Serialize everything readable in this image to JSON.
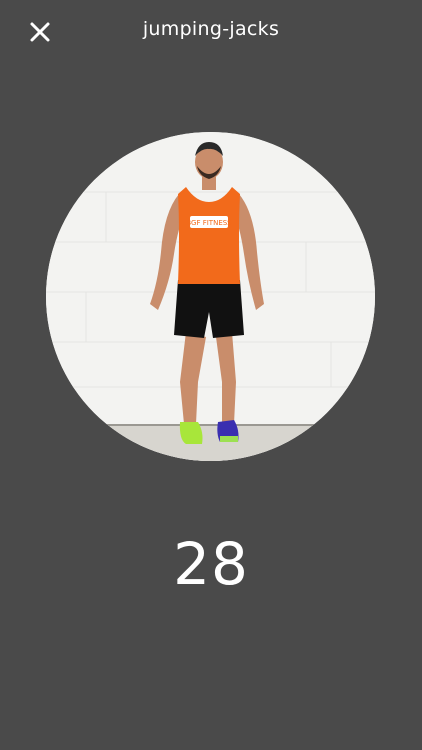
{
  "header": {
    "close_icon": "close-icon",
    "title": "jumping-jacks"
  },
  "exercise": {
    "image": "person-doing-jumping-jacks",
    "shirt_logo_text": "BGF FITNESS",
    "rep_count": "28"
  },
  "colors": {
    "background": "#4a4a4a",
    "text": "#ffffff",
    "shirt": "#f26a1b",
    "shorts": "#111111"
  }
}
